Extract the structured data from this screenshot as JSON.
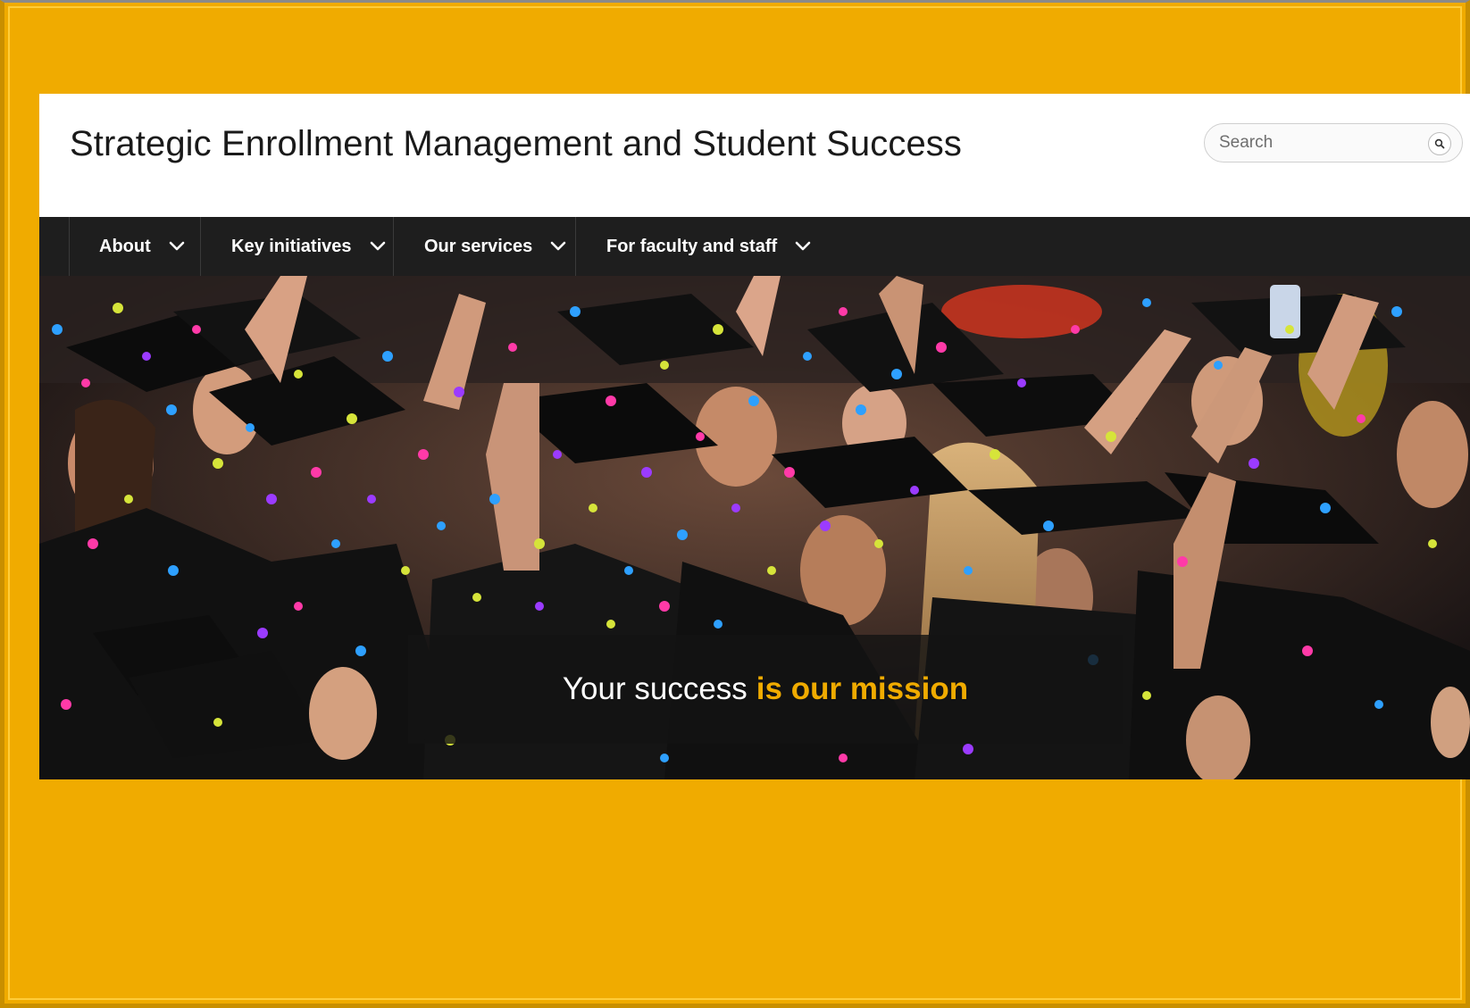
{
  "header": {
    "title": "Strategic Enrollment Management and Student Success",
    "search_placeholder": "Search",
    "search_icon": "search-icon"
  },
  "nav": {
    "items": [
      {
        "label": "About",
        "icon": "chevron-down-icon"
      },
      {
        "label": "Key initiatives",
        "icon": "chevron-down-icon"
      },
      {
        "label": "Our services",
        "icon": "chevron-down-icon"
      },
      {
        "label": "For faculty and staff",
        "icon": "chevron-down-icon"
      }
    ]
  },
  "hero": {
    "tagline_part1": "Your success",
    "tagline_part2": "is our mission"
  },
  "colors": {
    "brand_gold": "#f0ab00",
    "nav_bg": "#1e1e1e",
    "banner_bg": "#141414"
  }
}
